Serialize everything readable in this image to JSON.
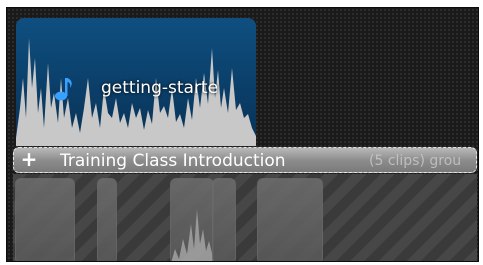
{
  "clip": {
    "title": "getting-starte",
    "icon": "music-note-icon",
    "colors": {
      "background": "#0a3d67",
      "waveform": "#c9c9c9"
    }
  },
  "group": {
    "expand_symbol": "+",
    "title": "Training Class  Introduction",
    "note": "(5 clips) grou"
  },
  "lane": {
    "clip_count": 5
  }
}
